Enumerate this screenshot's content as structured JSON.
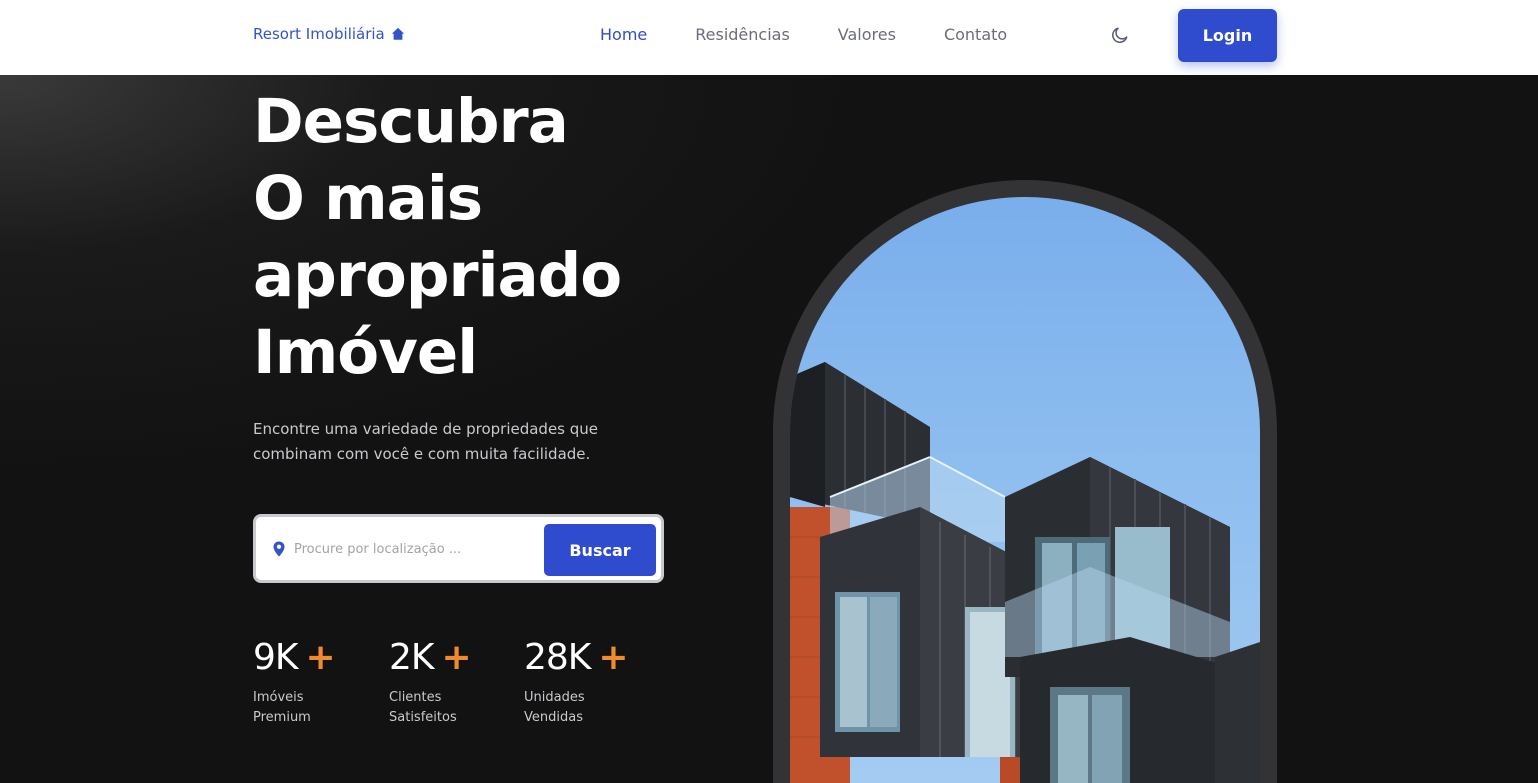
{
  "header": {
    "logo_text": "Resort Imobiliária",
    "nav": [
      {
        "label": "Home",
        "active": true
      },
      {
        "label": "Residências",
        "active": false
      },
      {
        "label": "Valores",
        "active": false
      },
      {
        "label": "Contato",
        "active": false
      }
    ],
    "login_label": "Login"
  },
  "hero": {
    "title_lines": [
      "Descubra",
      "O mais",
      "apropriado",
      "Imóvel"
    ],
    "subtitle": "Encontre uma variedade de propriedades que combinam com você e com muita facilidade.",
    "search": {
      "placeholder": "Procure por localização ...",
      "button_label": "Buscar"
    },
    "stats": [
      {
        "value": "9K",
        "plus": "+",
        "label": "Imóveis\nPremium"
      },
      {
        "value": "2K",
        "plus": "+",
        "label": "Clientes\nSatisfeitos"
      },
      {
        "value": "28K",
        "plus": "+",
        "label": "Unidades\nVendidas"
      }
    ]
  },
  "icons": {
    "logo": "house-icon",
    "theme": "moon-icon",
    "search": "map-pin-icon"
  },
  "colors": {
    "accent": "#2f4ccf",
    "plus": "#f08a2c",
    "background": "#121212"
  }
}
